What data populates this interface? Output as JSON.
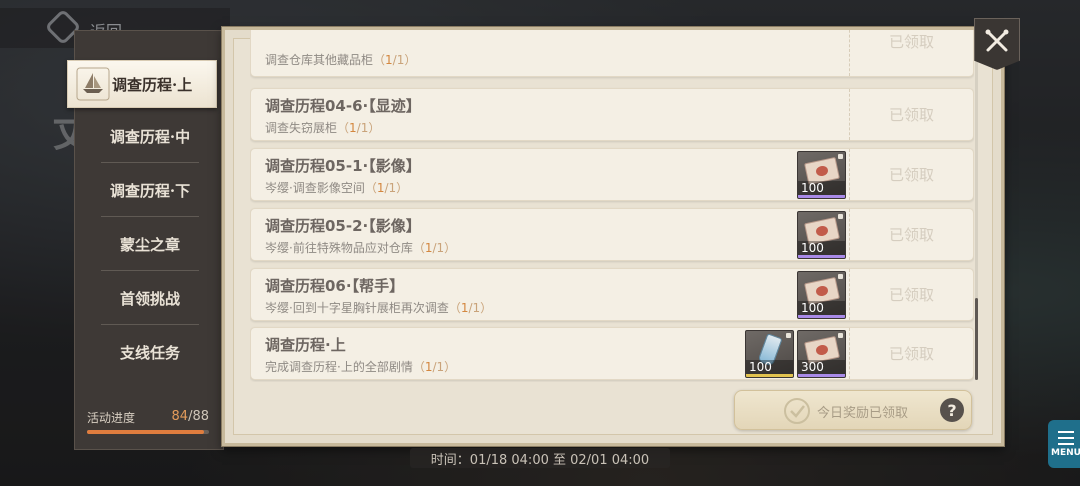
{
  "header": {
    "back_label": "返回"
  },
  "ghost_title": "丈",
  "tabs": [
    {
      "label": "调查历程·上",
      "active": true
    },
    {
      "label": "调查历程·中"
    },
    {
      "label": "调查历程·下"
    },
    {
      "label": "蒙尘之章"
    },
    {
      "label": "首领挑战"
    },
    {
      "label": "支线任务"
    }
  ],
  "progress": {
    "label": "活动进度",
    "current": "84",
    "separator": "/",
    "total": "88",
    "fraction": 0.955
  },
  "quests": [
    {
      "title": "",
      "desc": "调查仓库其他藏品柜",
      "prog_open": "（",
      "prog_cur": "1",
      "prog_rest": "/1）",
      "claim": "已领取",
      "rewards": []
    },
    {
      "title": "调查历程04-6·【显迹】",
      "desc": "调查失窃展柜",
      "prog_open": "（",
      "prog_cur": "1",
      "prog_rest": "/1）",
      "claim": "已领取",
      "rewards": []
    },
    {
      "title": "调查历程05-1·【影像】",
      "desc": "岑缨·调查影像空间",
      "prog_open": "（",
      "prog_cur": "1",
      "prog_rest": "/1）",
      "claim": "已领取",
      "rewards": [
        {
          "icon": "ticket-icon",
          "count": "100"
        }
      ]
    },
    {
      "title": "调查历程05-2·【影像】",
      "desc": "岑缨·前往特殊物品应对仓库",
      "prog_open": "（",
      "prog_cur": "1",
      "prog_rest": "/1）",
      "claim": "已领取",
      "rewards": [
        {
          "icon": "ticket-icon",
          "count": "100"
        }
      ]
    },
    {
      "title": "调查历程06·【帮手】",
      "desc": "岑缨·回到十字星胸针展柜再次调查",
      "prog_open": "（",
      "prog_cur": "1",
      "prog_rest": "/1）",
      "claim": "已领取",
      "rewards": [
        {
          "icon": "ticket-icon",
          "count": "100"
        }
      ]
    },
    {
      "title": "调查历程·上",
      "desc": "完成调查历程·上的全部剧情",
      "prog_open": "（",
      "prog_cur": "1",
      "prog_rest": "/1）",
      "claim": "已领取",
      "rewards": [
        {
          "icon": "vial-icon",
          "count": "100"
        },
        {
          "icon": "ticket-icon",
          "count": "300"
        }
      ]
    }
  ],
  "daily_button": {
    "label": "今日奖励已领取"
  },
  "help": {
    "glyph": "?"
  },
  "time_bar": {
    "text": "时间：01/18 04:00 至 02/01 04:00"
  },
  "menu": {
    "label": "MENU"
  },
  "colors": {
    "accent": "#e07d3e",
    "progress_highlight": "#d4873f",
    "menu_bg": "#1f6f8b"
  }
}
